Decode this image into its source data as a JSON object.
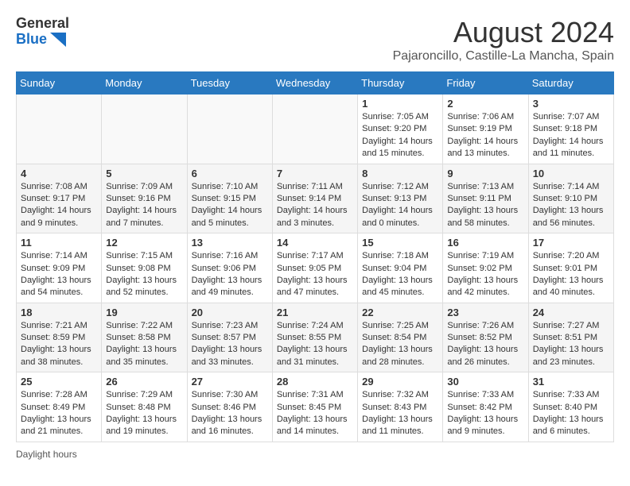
{
  "header": {
    "logo_general": "General",
    "logo_blue": "Blue",
    "month_title": "August 2024",
    "location": "Pajaroncillo, Castille-La Mancha, Spain"
  },
  "days_of_week": [
    "Sunday",
    "Monday",
    "Tuesday",
    "Wednesday",
    "Thursday",
    "Friday",
    "Saturday"
  ],
  "footer": {
    "daylight_label": "Daylight hours"
  },
  "weeks": [
    [
      {
        "day": "",
        "info": ""
      },
      {
        "day": "",
        "info": ""
      },
      {
        "day": "",
        "info": ""
      },
      {
        "day": "",
        "info": ""
      },
      {
        "day": "1",
        "info": "Sunrise: 7:05 AM\nSunset: 9:20 PM\nDaylight: 14 hours and 15 minutes."
      },
      {
        "day": "2",
        "info": "Sunrise: 7:06 AM\nSunset: 9:19 PM\nDaylight: 14 hours and 13 minutes."
      },
      {
        "day": "3",
        "info": "Sunrise: 7:07 AM\nSunset: 9:18 PM\nDaylight: 14 hours and 11 minutes."
      }
    ],
    [
      {
        "day": "4",
        "info": "Sunrise: 7:08 AM\nSunset: 9:17 PM\nDaylight: 14 hours and 9 minutes."
      },
      {
        "day": "5",
        "info": "Sunrise: 7:09 AM\nSunset: 9:16 PM\nDaylight: 14 hours and 7 minutes."
      },
      {
        "day": "6",
        "info": "Sunrise: 7:10 AM\nSunset: 9:15 PM\nDaylight: 14 hours and 5 minutes."
      },
      {
        "day": "7",
        "info": "Sunrise: 7:11 AM\nSunset: 9:14 PM\nDaylight: 14 hours and 3 minutes."
      },
      {
        "day": "8",
        "info": "Sunrise: 7:12 AM\nSunset: 9:13 PM\nDaylight: 14 hours and 0 minutes."
      },
      {
        "day": "9",
        "info": "Sunrise: 7:13 AM\nSunset: 9:11 PM\nDaylight: 13 hours and 58 minutes."
      },
      {
        "day": "10",
        "info": "Sunrise: 7:14 AM\nSunset: 9:10 PM\nDaylight: 13 hours and 56 minutes."
      }
    ],
    [
      {
        "day": "11",
        "info": "Sunrise: 7:14 AM\nSunset: 9:09 PM\nDaylight: 13 hours and 54 minutes."
      },
      {
        "day": "12",
        "info": "Sunrise: 7:15 AM\nSunset: 9:08 PM\nDaylight: 13 hours and 52 minutes."
      },
      {
        "day": "13",
        "info": "Sunrise: 7:16 AM\nSunset: 9:06 PM\nDaylight: 13 hours and 49 minutes."
      },
      {
        "day": "14",
        "info": "Sunrise: 7:17 AM\nSunset: 9:05 PM\nDaylight: 13 hours and 47 minutes."
      },
      {
        "day": "15",
        "info": "Sunrise: 7:18 AM\nSunset: 9:04 PM\nDaylight: 13 hours and 45 minutes."
      },
      {
        "day": "16",
        "info": "Sunrise: 7:19 AM\nSunset: 9:02 PM\nDaylight: 13 hours and 42 minutes."
      },
      {
        "day": "17",
        "info": "Sunrise: 7:20 AM\nSunset: 9:01 PM\nDaylight: 13 hours and 40 minutes."
      }
    ],
    [
      {
        "day": "18",
        "info": "Sunrise: 7:21 AM\nSunset: 8:59 PM\nDaylight: 13 hours and 38 minutes."
      },
      {
        "day": "19",
        "info": "Sunrise: 7:22 AM\nSunset: 8:58 PM\nDaylight: 13 hours and 35 minutes."
      },
      {
        "day": "20",
        "info": "Sunrise: 7:23 AM\nSunset: 8:57 PM\nDaylight: 13 hours and 33 minutes."
      },
      {
        "day": "21",
        "info": "Sunrise: 7:24 AM\nSunset: 8:55 PM\nDaylight: 13 hours and 31 minutes."
      },
      {
        "day": "22",
        "info": "Sunrise: 7:25 AM\nSunset: 8:54 PM\nDaylight: 13 hours and 28 minutes."
      },
      {
        "day": "23",
        "info": "Sunrise: 7:26 AM\nSunset: 8:52 PM\nDaylight: 13 hours and 26 minutes."
      },
      {
        "day": "24",
        "info": "Sunrise: 7:27 AM\nSunset: 8:51 PM\nDaylight: 13 hours and 23 minutes."
      }
    ],
    [
      {
        "day": "25",
        "info": "Sunrise: 7:28 AM\nSunset: 8:49 PM\nDaylight: 13 hours and 21 minutes."
      },
      {
        "day": "26",
        "info": "Sunrise: 7:29 AM\nSunset: 8:48 PM\nDaylight: 13 hours and 19 minutes."
      },
      {
        "day": "27",
        "info": "Sunrise: 7:30 AM\nSunset: 8:46 PM\nDaylight: 13 hours and 16 minutes."
      },
      {
        "day": "28",
        "info": "Sunrise: 7:31 AM\nSunset: 8:45 PM\nDaylight: 13 hours and 14 minutes."
      },
      {
        "day": "29",
        "info": "Sunrise: 7:32 AM\nSunset: 8:43 PM\nDaylight: 13 hours and 11 minutes."
      },
      {
        "day": "30",
        "info": "Sunrise: 7:33 AM\nSunset: 8:42 PM\nDaylight: 13 hours and 9 minutes."
      },
      {
        "day": "31",
        "info": "Sunrise: 7:33 AM\nSunset: 8:40 PM\nDaylight: 13 hours and 6 minutes."
      }
    ]
  ]
}
